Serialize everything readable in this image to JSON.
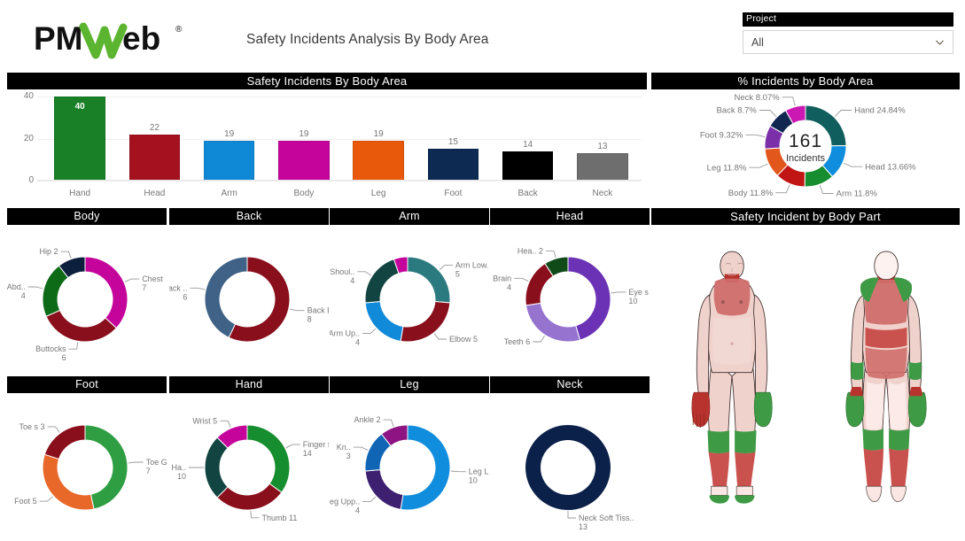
{
  "header": {
    "logo_text": "PMWeb",
    "logo_mark": "pmweb-logo",
    "title": "Safety Incidents Analysis By Body Area",
    "slicer": {
      "label": "Project",
      "value": "All",
      "icon": "chevron-down-icon"
    }
  },
  "panels": {
    "bar": "Safety Incidents By Body Area",
    "pct": "% Incidents by Body Area",
    "body": "Body",
    "back": "Back",
    "arm": "Arm",
    "head": "Head",
    "foot": "Foot",
    "hand": "Hand",
    "leg": "Leg",
    "neck": "Neck",
    "figure": "Safety Incident by Body Part"
  },
  "chart_data": [
    {
      "type": "bar",
      "title": "Safety Incidents By Body Area",
      "xlabel": "",
      "ylabel": "",
      "ylim": [
        0,
        40
      ],
      "yticks": [
        0,
        20,
        40
      ],
      "grid": true,
      "legend": "none",
      "categories": [
        "Hand",
        "Head",
        "Arm",
        "Body",
        "Leg",
        "Foot",
        "Back",
        "Neck"
      ],
      "values": [
        40,
        22,
        19,
        19,
        19,
        15,
        14,
        13
      ],
      "colors": [
        "#1a8028",
        "#a61120",
        "#0f88d6",
        "#c5049c",
        "#e8590c",
        "#0c2a52",
        "#000000",
        "#6e6e6e"
      ],
      "label_inside": [
        true,
        false,
        false,
        false,
        false,
        false,
        false,
        false
      ]
    },
    {
      "type": "pie",
      "title": "% Incidents by Body Area",
      "center_value": "161",
      "center_label": "Incidents",
      "labels": [
        "Hand 24.84%",
        "Head 13.66%",
        "Arm 11.8%",
        "Body 11.8%",
        "Leg 11.8%",
        "Foot 9.32%",
        "Back 8.7%",
        "Neck 8.07%"
      ],
      "categories": [
        "Hand",
        "Head",
        "Arm",
        "Body",
        "Leg",
        "Foot",
        "Back",
        "Neck"
      ],
      "values": [
        24.84,
        13.66,
        11.8,
        11.8,
        11.8,
        9.32,
        8.7,
        8.07
      ],
      "colors": [
        "#115e5e",
        "#118ddd",
        "#168d2e",
        "#c11414",
        "#e2571b",
        "#7b2fa8",
        "#11274f",
        "#cb18b2"
      ]
    },
    {
      "type": "pie",
      "title": "Body",
      "labels": [
        "Chest",
        "Buttocks",
        "Abd..",
        "Hip"
      ],
      "values": [
        7,
        6,
        4,
        2
      ],
      "colors": [
        "#c5049c",
        "#8a0f1c",
        "#0d6b18",
        "#0c1f3d"
      ]
    },
    {
      "type": "pie",
      "title": "Back",
      "labels": [
        "Back Lo..",
        "Back .."
      ],
      "values": [
        8,
        6
      ],
      "colors": [
        "#8a0f1c",
        "#3f6286"
      ]
    },
    {
      "type": "pie",
      "title": "Arm",
      "labels": [
        "Arm Low..",
        "Elbow",
        "Arm Up..",
        "Shoul..",
        ""
      ],
      "values": [
        5,
        5,
        4,
        4,
        1
      ],
      "colors": [
        "#2b7a7f",
        "#8a0f1c",
        "#128ada",
        "#124442",
        "#c5049c"
      ]
    },
    {
      "type": "pie",
      "title": "Head",
      "labels": [
        "Eye s",
        "Teeth",
        "Brain",
        "Hea.."
      ],
      "values": [
        10,
        6,
        4,
        2
      ],
      "colors": [
        "#6b32b5",
        "#9573cf",
        "#8a0f1c",
        "#104a18"
      ]
    },
    {
      "type": "pie",
      "title": "Foot",
      "labels": [
        "Toe G..",
        "Foot",
        "Toe s"
      ],
      "values": [
        7,
        5,
        3
      ],
      "colors": [
        "#2f9e42",
        "#e8682a",
        "#8a0f1c"
      ]
    },
    {
      "type": "pie",
      "title": "Hand",
      "labels": [
        "Finger s",
        "Thumb",
        "Ha..",
        "Wrist"
      ],
      "values": [
        14,
        11,
        10,
        5
      ],
      "colors": [
        "#168d2e",
        "#8a0f1c",
        "#124442",
        "#c5049c"
      ]
    },
    {
      "type": "pie",
      "title": "Leg",
      "labels": [
        "Leg L..",
        "Leg Upp..",
        "Kn..",
        "Ankle"
      ],
      "values": [
        10,
        4,
        3,
        2
      ],
      "colors": [
        "#118ddd",
        "#3d2070",
        "#1065b5",
        "#8e1484"
      ]
    },
    {
      "type": "pie",
      "title": "Neck",
      "labels": [
        "Neck Soft Tiss.."
      ],
      "values": [
        13
      ],
      "colors": [
        "#0c2149"
      ]
    }
  ],
  "donut_labels": {
    "body": [
      {
        "name": "Chest",
        "value": "7"
      },
      {
        "name": "Buttocks",
        "value": "6"
      },
      {
        "name": "Abd..",
        "value": "4"
      },
      {
        "name": "Hip 2",
        "value": ""
      }
    ],
    "back": [
      {
        "name": "Back Lo..",
        "value": "8"
      },
      {
        "name": "Back ..",
        "value": "6"
      }
    ],
    "arm": [
      {
        "name": "Arm Low..",
        "value": "5"
      },
      {
        "name": "Elbow 5",
        "value": ""
      },
      {
        "name": "Arm Up..",
        "value": "4"
      },
      {
        "name": "Shoul..",
        "value": "4"
      }
    ],
    "head": [
      {
        "name": "Eye s",
        "value": "10"
      },
      {
        "name": "Teeth 6",
        "value": ""
      },
      {
        "name": "Brain",
        "value": "4"
      },
      {
        "name": "Hea.. 2",
        "value": ""
      }
    ],
    "foot": [
      {
        "name": "Toe G..",
        "value": "7"
      },
      {
        "name": "Foot 5",
        "value": ""
      },
      {
        "name": "Toe s 3",
        "value": ""
      }
    ],
    "hand": [
      {
        "name": "Finger s",
        "value": "14"
      },
      {
        "name": "Thumb 11",
        "value": ""
      },
      {
        "name": "Ha..",
        "value": "10"
      },
      {
        "name": "Wrist 5",
        "value": ""
      }
    ],
    "leg": [
      {
        "name": "Leg L..",
        "value": "10"
      },
      {
        "name": "Leg Upp..",
        "value": "4"
      },
      {
        "name": "Kn..",
        "value": "3"
      },
      {
        "name": "Ankle 2",
        "value": ""
      }
    ],
    "neck": [
      {
        "name": "Neck Soft Tiss..",
        "value": "13"
      }
    ]
  },
  "figure": {
    "views": [
      "front",
      "back"
    ],
    "skin": "#f0d2cd",
    "highlight_red": "#c9524f",
    "highlight_deep_red": "#b8332e",
    "highlight_green": "#3f9a46"
  }
}
